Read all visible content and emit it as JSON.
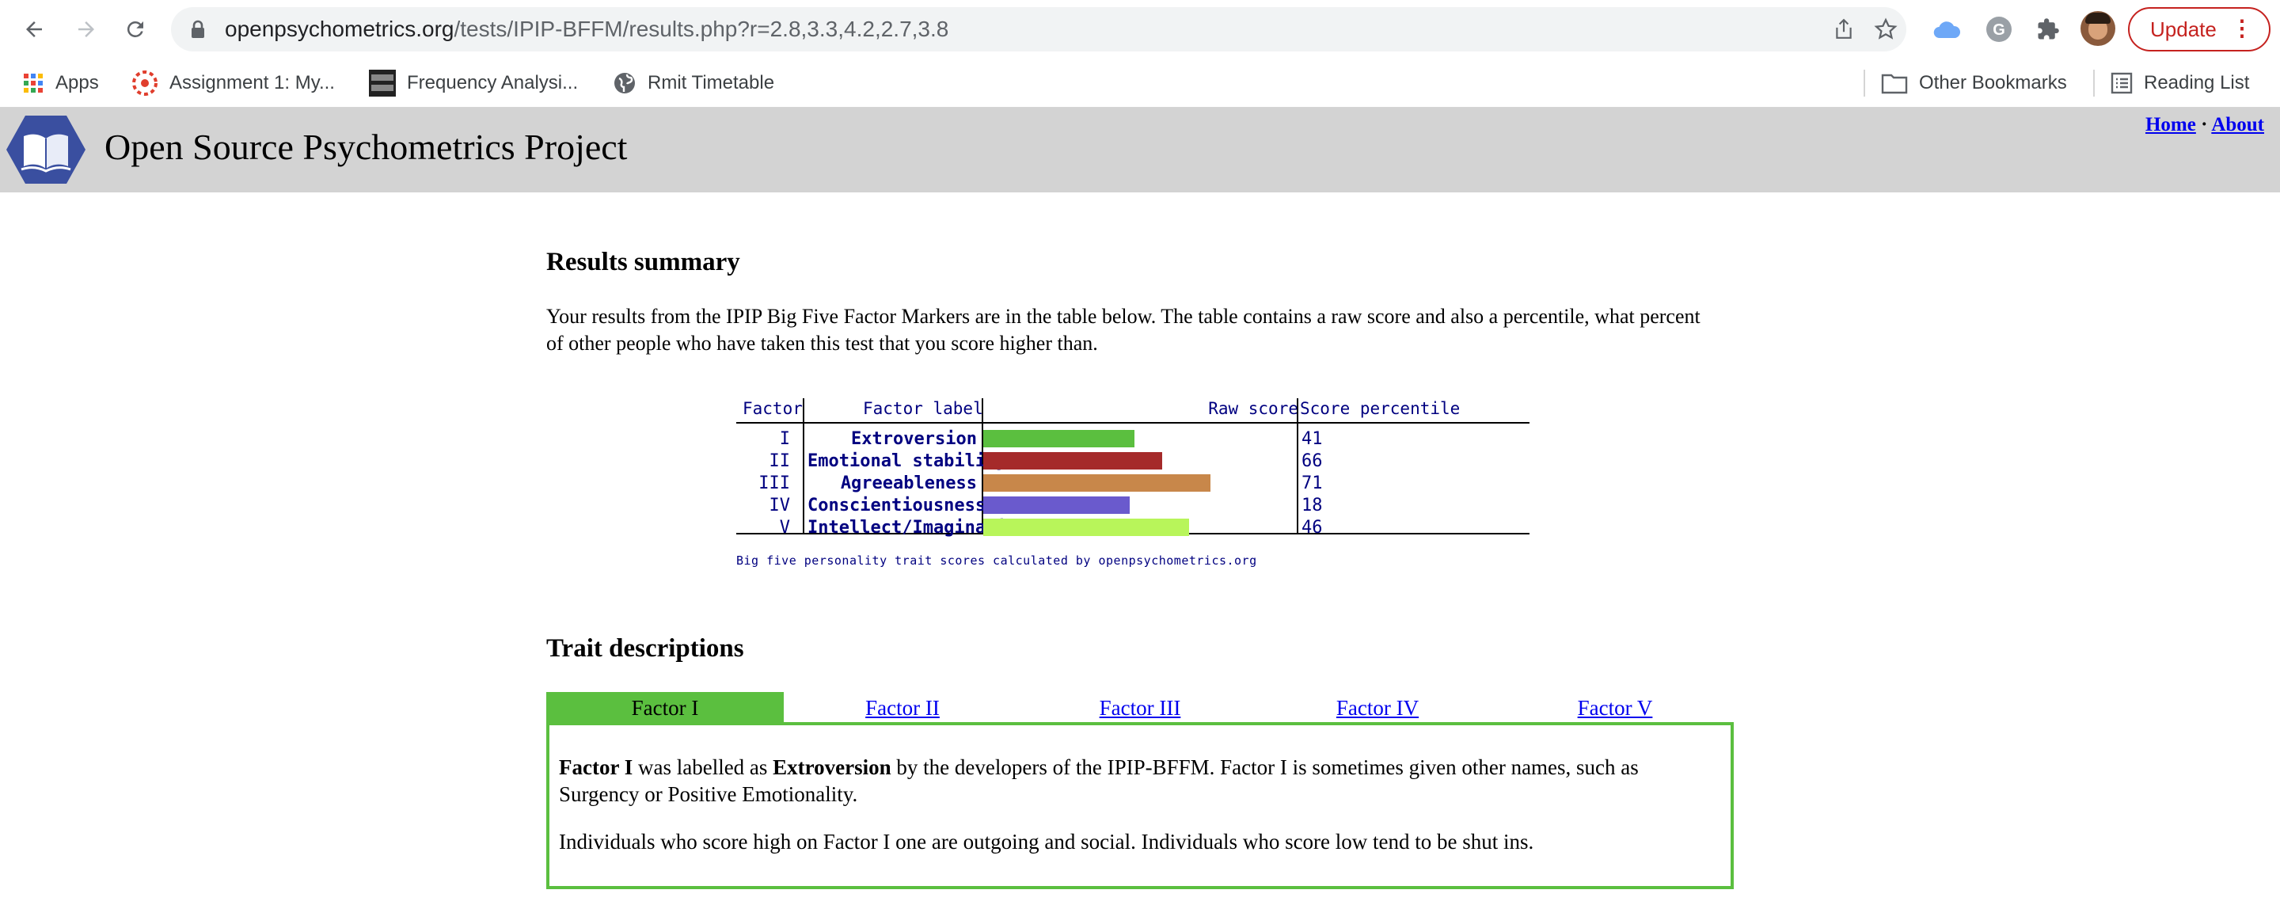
{
  "browser": {
    "url_domain": "openpsychometrics.org",
    "url_path": "/tests/IPIP-BFFM/results.php?r=2.8,3.3,4.2,2.7,3.8",
    "update_label": "Update",
    "bookmarks": [
      {
        "label": "Apps",
        "icon": "apps-grid-icon"
      },
      {
        "label": "Assignment 1: My...",
        "icon": "canvas-icon"
      },
      {
        "label": "Frequency Analysi...",
        "icon": "crypto-corner-icon"
      },
      {
        "label": "Rmit Timetable",
        "icon": "globe-icon"
      }
    ],
    "other_bookmarks": "Other Bookmarks",
    "reading_list": "Reading List"
  },
  "site": {
    "title": "Open Source Psychometrics Project",
    "nav": {
      "home": "Home",
      "separator": "·",
      "about": "About"
    }
  },
  "results": {
    "heading": "Results summary",
    "intro": "Your results from the IPIP Big Five Factor Markers are in the table below. The table contains a raw score and also a percentile, what percent of other people who have taken this test that you score higher than."
  },
  "chart_data": {
    "type": "table",
    "columns": [
      "Factor",
      "Factor label",
      "Raw score",
      "Score percentile"
    ],
    "rows": [
      {
        "factor": "I",
        "label": "Extroversion",
        "raw_score": 2.8,
        "percentile": "41",
        "color": "#5bbf3f"
      },
      {
        "factor": "II",
        "label": "Emotional stability",
        "raw_score": 3.3,
        "percentile": "66",
        "color": "#a52a2a"
      },
      {
        "factor": "III",
        "label": "Agreeableness",
        "raw_score": 4.2,
        "percentile": "71",
        "color": "#c8874a"
      },
      {
        "factor": "IV",
        "label": "Conscientiousness",
        "raw_score": 2.7,
        "percentile": "18",
        "color": "#6a5acd"
      },
      {
        "factor": "V",
        "label": "Intellect/Imagination",
        "raw_score": 3.8,
        "percentile": "46",
        "color": "#b8f55a"
      }
    ],
    "raw_score_range": [
      0,
      5
    ],
    "caption": "Big five personality trait scores calculated by openpsychometrics.org"
  },
  "traits": {
    "heading": "Trait descriptions",
    "tabs": [
      "Factor I",
      "Factor II",
      "Factor III",
      "Factor IV",
      "Factor V"
    ],
    "active_tab": 0,
    "desc_p1_factor": "Factor I",
    "desc_p1_mid": " was labelled as ",
    "desc_p1_label": "Extroversion",
    "desc_p1_rest": " by the developers of the IPIP-BFFM. Factor I is sometimes given other names, such as Surgency or Positive Emotionality.",
    "desc_p2": "Individuals who score high on Factor I one are outgoing and social. Individuals who score low tend to be shut ins."
  },
  "colors": {
    "tab_active": "#5bbf3f",
    "header_bg": "#d3d3d3",
    "link": "#0000ee",
    "table_text": "#000080"
  }
}
